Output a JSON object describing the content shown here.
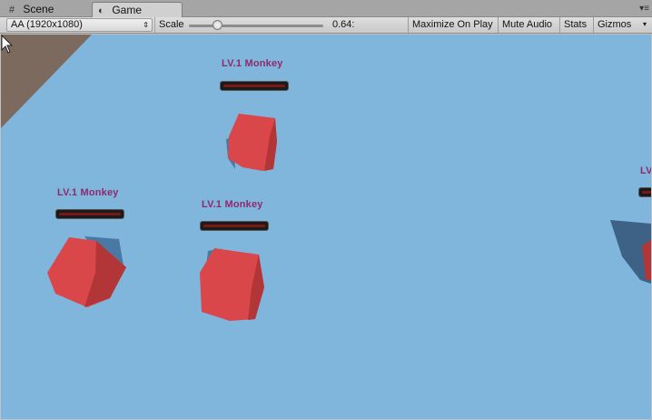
{
  "tabs": [
    {
      "label": "Scene",
      "icon": "grid-icon"
    },
    {
      "label": "Game",
      "icon": "pacman-icon",
      "active": true
    }
  ],
  "toolbar": {
    "aspect": "AA (1920x1080)",
    "scale_label": "Scale",
    "scale_value": "0.64:",
    "scale_fraction": 0.2,
    "maximize_on_play": "Maximize On Play",
    "mute_audio": "Mute Audio",
    "stats": "Stats",
    "gizmos": "Gizmos"
  },
  "scene": {
    "enemies": [
      {
        "label": "LV.1  Monkey"
      },
      {
        "label": "LV.1  Monkey"
      },
      {
        "label": "LV.1  Monkey"
      },
      {
        "label": "LV"
      }
    ],
    "colors": {
      "ground": "#80b5dc",
      "cube": "#d9474b",
      "label": "#8e2a6e",
      "hp": "#7a1717"
    }
  }
}
